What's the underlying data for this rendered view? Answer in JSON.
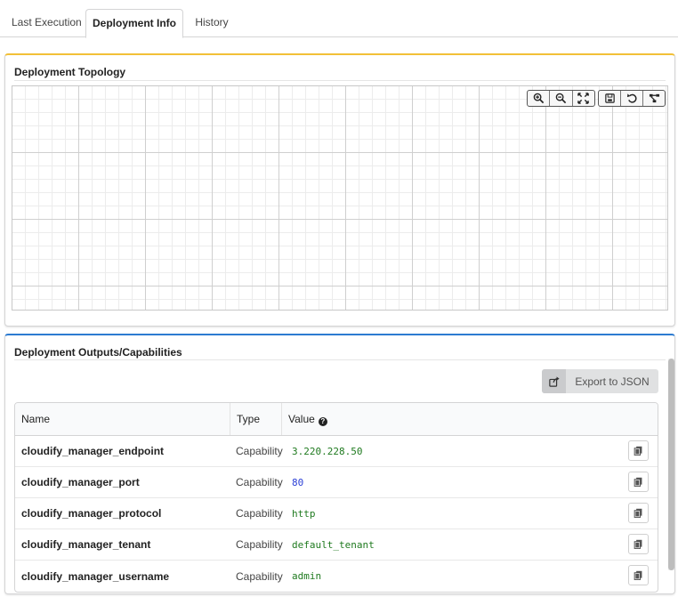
{
  "tabs": [
    {
      "label": "Last Execution",
      "active": false
    },
    {
      "label": "Deployment Info",
      "active": true
    },
    {
      "label": "History",
      "active": false
    }
  ],
  "topology": {
    "title": "Deployment Topology",
    "accent_color": "#f2c037",
    "toolbar": [
      "zoom-in-icon",
      "zoom-out-icon",
      "fit-screen-icon",
      "save-icon",
      "undo-icon",
      "layout-icon"
    ]
  },
  "outputs": {
    "title": "Deployment Outputs/Capabilities",
    "accent_color": "#2c7bd1",
    "export_label": "Export to JSON",
    "columns": {
      "name": "Name",
      "type": "Type",
      "value": "Value"
    },
    "rows": [
      {
        "name": "cloudify_manager_endpoint",
        "type": "Capability",
        "value": "3.220.228.50",
        "value_color": "#1f7a1f"
      },
      {
        "name": "cloudify_manager_port",
        "type": "Capability",
        "value": "80",
        "value_color": "#2a3fd6"
      },
      {
        "name": "cloudify_manager_protocol",
        "type": "Capability",
        "value": "http",
        "value_color": "#1f7a1f"
      },
      {
        "name": "cloudify_manager_tenant",
        "type": "Capability",
        "value": "default_tenant",
        "value_color": "#1f7a1f"
      },
      {
        "name": "cloudify_manager_username",
        "type": "Capability",
        "value": "admin",
        "value_color": "#1f7a1f"
      }
    ]
  }
}
